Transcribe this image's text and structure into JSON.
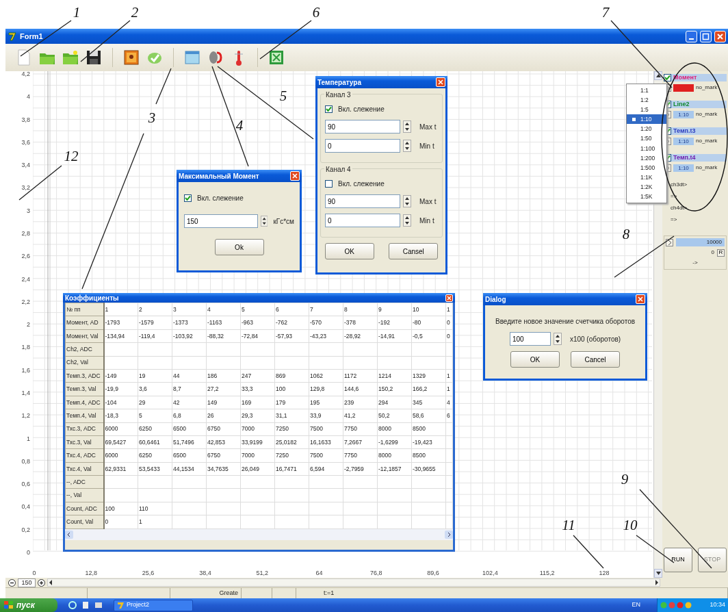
{
  "window": {
    "title": "Form1"
  },
  "chart": {
    "y_ticks": [
      "4,2",
      "4",
      "3,8",
      "3,6",
      "3,4",
      "3,2",
      "3",
      "2,8",
      "2,6",
      "2,4",
      "2,2",
      "2",
      "1,8",
      "1,6",
      "1,4",
      "1,2",
      "1",
      "0,8",
      "0,6",
      "0,4",
      "0,2",
      "0"
    ],
    "x_ticks": [
      "0",
      "12,8",
      "25,6",
      "38,4",
      "51,2",
      "64",
      "76,8",
      "89,6",
      "102,4",
      "115,2",
      "128"
    ]
  },
  "moment_dialog": {
    "title": "Максимальный Момент",
    "tracking": {
      "label": "Вкл. слежение",
      "checked": true
    },
    "value": "150",
    "unit": "кГс*см",
    "ok_button": "Ok"
  },
  "temperature_dialog": {
    "title": "Температура",
    "groups": [
      {
        "title": "Канал 3",
        "tracking": {
          "label": "Вкл. слежение",
          "checked": true
        },
        "fields": [
          {
            "value": "90",
            "label": "Max t"
          },
          {
            "value": "0",
            "label": "Min t"
          }
        ]
      },
      {
        "title": "Канал 4",
        "tracking": {
          "label": "Вкл. слежение",
          "checked": false
        },
        "fields": [
          {
            "value": "90",
            "label": "Max t"
          },
          {
            "value": "0",
            "label": "Min t"
          }
        ]
      }
    ],
    "buttons": [
      "OK",
      "Cansel"
    ]
  },
  "coefficients_window": {
    "title": "Коэффициенты",
    "columns": [
      "№ пп",
      "1",
      "2",
      "3",
      "4",
      "5",
      "6",
      "7",
      "8",
      "9",
      "10",
      "1"
    ],
    "rows": [
      {
        "cells": [
          "Момент, AD",
          "-1793",
          "-1579",
          "-1373",
          "-1163",
          "-963",
          "-762",
          "-570",
          "-378",
          "-192",
          "-80",
          "0"
        ]
      },
      {
        "cells": [
          "Момент, Val",
          "-134,94",
          "-119,4",
          "-103,92",
          "-88,32",
          "-72,84",
          "-57,93",
          "-43,23",
          "-28,92",
          "-14,91",
          "-0,5",
          "0"
        ]
      },
      {
        "cells": [
          "Ch2, ADC"
        ]
      },
      {
        "cells": [
          "Ch2, Val"
        ]
      },
      {
        "cells": [
          "Темп.3, ADC",
          "-149",
          "19",
          "44",
          "186",
          "247",
          "869",
          "1062",
          "1172",
          "1214",
          "1329",
          "1"
        ]
      },
      {
        "cells": [
          "Темп.3, Val",
          "-19,9",
          "3,6",
          "8,7",
          "27,2",
          "33,3",
          "100",
          "129,8",
          "144,6",
          "150,2",
          "166,2",
          "1"
        ]
      },
      {
        "cells": [
          "Темп.4, ADC",
          "-104",
          "29",
          "42",
          "149",
          "169",
          "179",
          "195",
          "239",
          "294",
          "345",
          "4"
        ]
      },
      {
        "cells": [
          "Темп.4, Val",
          "-18,3",
          "5",
          "6,8",
          "26",
          "29,3",
          "31,1",
          "33,9",
          "41,2",
          "50,2",
          "58,6",
          "6"
        ]
      },
      {
        "cells": [
          "Тхс.3, ADC",
          "6000",
          "6250",
          "6500",
          "6750",
          "7000",
          "7250",
          "7500",
          "7750",
          "8000",
          "8500"
        ]
      },
      {
        "cells": [
          "Тхс.3, Val",
          "69,5427",
          "60,6461",
          "51,7496",
          "42,853",
          "33,9199",
          "25,0182",
          "16,1633",
          "7,2667",
          "-1,6299",
          "-19,423"
        ]
      },
      {
        "cells": [
          "Тхс.4, ADC",
          "6000",
          "6250",
          "6500",
          "6750",
          "7000",
          "7250",
          "7500",
          "7750",
          "8000",
          "8500"
        ]
      },
      {
        "cells": [
          "Тхс.4, Val",
          "62,9331",
          "53,5433",
          "44,1534",
          "34,7635",
          "26,049",
          "16,7471",
          "6,594",
          "-2,7959",
          "-12,1857",
          "-30,9655"
        ]
      },
      {
        "cells": [
          "--, ADC"
        ]
      },
      {
        "cells": [
          "--, Val"
        ]
      },
      {
        "cells": [
          "Count, ADC",
          "100",
          "110"
        ]
      },
      {
        "cells": [
          "Count, Val",
          "0",
          "1"
        ]
      }
    ]
  },
  "counter_dialog": {
    "title": "Dialog",
    "prompt": "Введите новое значение счетчика оборотов",
    "value": "100",
    "unit": "x100 (оборотов)",
    "buttons": [
      "OK",
      "Cancel"
    ]
  },
  "scale_dropdown": {
    "options": [
      {
        "label": "1:1",
        "selected": false
      },
      {
        "label": "1:2",
        "selected": false
      },
      {
        "label": "1:5",
        "selected": false
      },
      {
        "label": "1:10",
        "selected": true
      },
      {
        "label": "1:20",
        "selected": false
      },
      {
        "label": "1:50",
        "selected": false
      },
      {
        "label": "1:100",
        "selected": false
      },
      {
        "label": "1:200",
        "selected": false
      },
      {
        "label": "1:500",
        "selected": false
      },
      {
        "label": "1:1K",
        "selected": false
      },
      {
        "label": "1:2K",
        "selected": false
      },
      {
        "label": "1:5K",
        "selected": false
      }
    ]
  },
  "channels": [
    {
      "name": "Момент",
      "color": "#e0207a",
      "checked": true,
      "kind": "swatch",
      "mark": "no_mark"
    },
    {
      "name": "Line2",
      "color": "#108830",
      "checked": true,
      "kind": "scale",
      "scale": "1:10",
      "mark": "no_mark"
    },
    {
      "name": "Темп.t3",
      "color": "#3040c0",
      "checked": true,
      "kind": "scale",
      "scale": "1:10",
      "mark": "no_mark"
    },
    {
      "name": "Темп.t4",
      "color": "#7020b0",
      "checked": true,
      "kind": "scale",
      "scale": "1:10",
      "mark": "no_mark"
    }
  ],
  "channel_links": [
    "ch3dt>",
    "=>",
    "ch4dt>",
    "=>"
  ],
  "counter": {
    "value": "10000",
    "reset_value": "0",
    "reset_button": "R",
    "arrow": "->"
  },
  "run_button": {
    "label": "RUN",
    "disabled": false
  },
  "stop_button": {
    "label": "STOP",
    "disabled": true
  },
  "zoom": {
    "value": "150"
  },
  "status_bar": {
    "mode": "Greate",
    "time": "t:=1"
  },
  "taskbar": {
    "start": "пуск",
    "tasks": [
      {
        "label": "Project2",
        "selected": false
      }
    ],
    "language": "EN",
    "clock": "10:34"
  },
  "callouts": [
    "1",
    "2",
    "3",
    "4",
    "5",
    "6",
    "7",
    "8",
    "9",
    "10",
    "11",
    "12"
  ]
}
